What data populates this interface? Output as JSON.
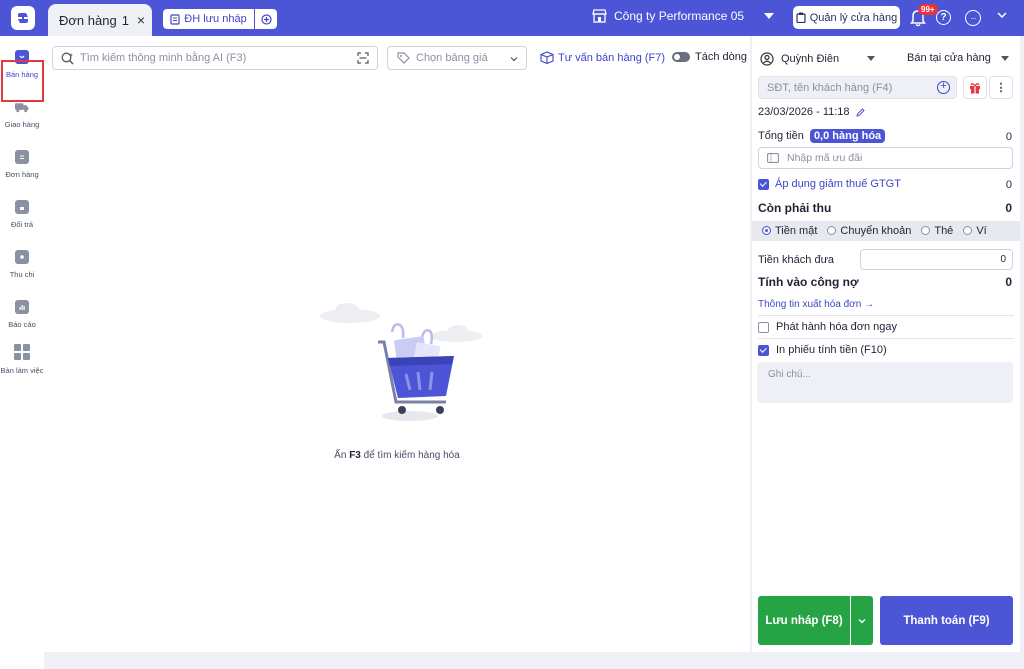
{
  "header": {
    "tab_label": "Đơn hàng",
    "tab_number": "1",
    "tab_close": "×",
    "draft_label": "ĐH lưu nháp",
    "company": "Công ty Performance 05",
    "store_manage": "Quản lý cửa hàng",
    "notification_count": "99+",
    "help": "?",
    "more": "···"
  },
  "sidebar": {
    "items": [
      {
        "label": "Bán hàng",
        "icon": "bag-icon"
      },
      {
        "label": "Giao hàng",
        "icon": "truck-icon"
      },
      {
        "label": "Đơn hàng",
        "icon": "order-icon"
      },
      {
        "label": "Đổi trả",
        "icon": "return-icon"
      },
      {
        "label": "Thu chi",
        "icon": "cash-icon"
      },
      {
        "label": "Báo cáo",
        "icon": "chart-icon"
      },
      {
        "label": "Bàn làm việc",
        "icon": "workspace-icon"
      }
    ]
  },
  "main": {
    "search_placeholder": "Tìm kiếm thông minh bằng AI (F3)",
    "price_placeholder": "Chọn bảng giá",
    "advise_label": "Tư vấn bán hàng (F7)",
    "split_label": "Tách dòng",
    "empty_prefix": "Ấn",
    "empty_key": "F3",
    "empty_suffix": "để tìm kiếm hàng hóa"
  },
  "order": {
    "staff": "Quỳnh Điên",
    "sale_mode": "Bán tại cửa hàng",
    "customer_placeholder": "SĐT, tên khách hàng (F4)",
    "datetime": "23/03/2026 - 11:18",
    "total_label": "Tổng tiền",
    "total_qty": "0,0 hàng hóa",
    "total_value": "0",
    "promo_placeholder": "Nhập mã ưu đãi",
    "vat_label": "Áp dụng giảm thuế GTGT",
    "vat_value": "0",
    "due_label": "Còn phải thu",
    "due_value": "0",
    "pay_methods": [
      "Tiền mặt",
      "Chuyển khoản",
      "Thẻ",
      "Ví"
    ],
    "cash_label": "Tiền khách đưa",
    "cash_value": "0",
    "debt_label": "Tính vào công nợ",
    "debt_value": "0",
    "invoice_link": "Thông tin xuất hóa đơn →",
    "issue_invoice": "Phát hành hóa đơn ngay",
    "print_receipt": "In phiếu tính tiền (F10)",
    "note_placeholder": "Ghi chú...",
    "save_label": "Lưu nháp (F8)",
    "pay_label": "Thanh toán (F9)"
  },
  "colors": {
    "brand": "#4b55d6",
    "save": "#26a445",
    "highlight": "#e4383f"
  }
}
